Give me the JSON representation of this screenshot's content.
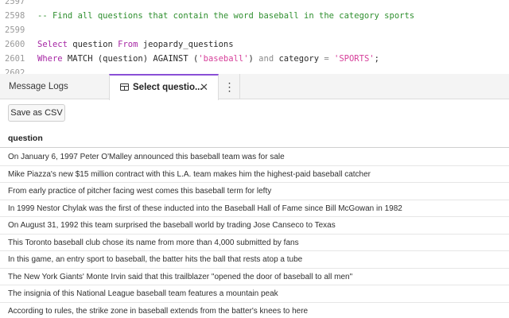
{
  "editor": {
    "lines": [
      {
        "num": "2597",
        "segments": []
      },
      {
        "num": "2598",
        "segments": [
          {
            "text": "-- Find all questions that contain the word baseball in the category sports",
            "kind": "comment"
          }
        ]
      },
      {
        "num": "2599",
        "segments": []
      },
      {
        "num": "2600",
        "segments": [
          {
            "text": "Select",
            "kind": "kw"
          },
          {
            "text": " question ",
            "kind": "plain"
          },
          {
            "text": "From",
            "kind": "kw"
          },
          {
            "text": " jeopardy_questions",
            "kind": "plain"
          }
        ]
      },
      {
        "num": "2601",
        "segments": [
          {
            "text": "Where",
            "kind": "kw"
          },
          {
            "text": " MATCH (question) AGAINST (",
            "kind": "plain"
          },
          {
            "text": "'baseball'",
            "kind": "str"
          },
          {
            "text": ") ",
            "kind": "plain"
          },
          {
            "text": "and",
            "kind": "op"
          },
          {
            "text": " category ",
            "kind": "plain"
          },
          {
            "text": "=",
            "kind": "op"
          },
          {
            "text": " ",
            "kind": "plain"
          },
          {
            "text": "'SPORTS'",
            "kind": "str"
          },
          {
            "text": ";",
            "kind": "plain"
          }
        ]
      },
      {
        "num": "2602",
        "segments": []
      }
    ]
  },
  "tabs": {
    "logs_label": "Message Logs",
    "active_label": "Select questio...",
    "close_glyph": "✕",
    "more_glyph": "⋮",
    "active_icon": "table-icon",
    "accent_color": "#8a4fd6"
  },
  "toolbar": {
    "save_label": "Save as CSV"
  },
  "results": {
    "column": "question",
    "rows": [
      "On January 6, 1997 Peter O'Malley announced this baseball team was for sale",
      "Mike Piazza's new $15 million contract with this L.A. team makes him the highest-paid baseball catcher",
      "From early practice of pitcher facing west comes this baseball term for lefty",
      "In 1999 Nestor Chylak was the first of these inducted into the Baseball Hall of Fame since Bill McGowan in 1982",
      "On August 31, 1992 this team surprised the baseball world by trading Jose Canseco to Texas",
      "This Toronto baseball club chose its name from more than 4,000 submitted by fans",
      "In this game, an entry sport to baseball, the batter hits the ball that rests atop a tube",
      "The New York Giants' Monte Irvin said that this trailblazer \"opened the door of baseball to all men\"",
      "The insignia of this National League baseball team features a mountain peak",
      "According to rules, the strike zone in baseball extends from the batter's knees to here"
    ]
  }
}
